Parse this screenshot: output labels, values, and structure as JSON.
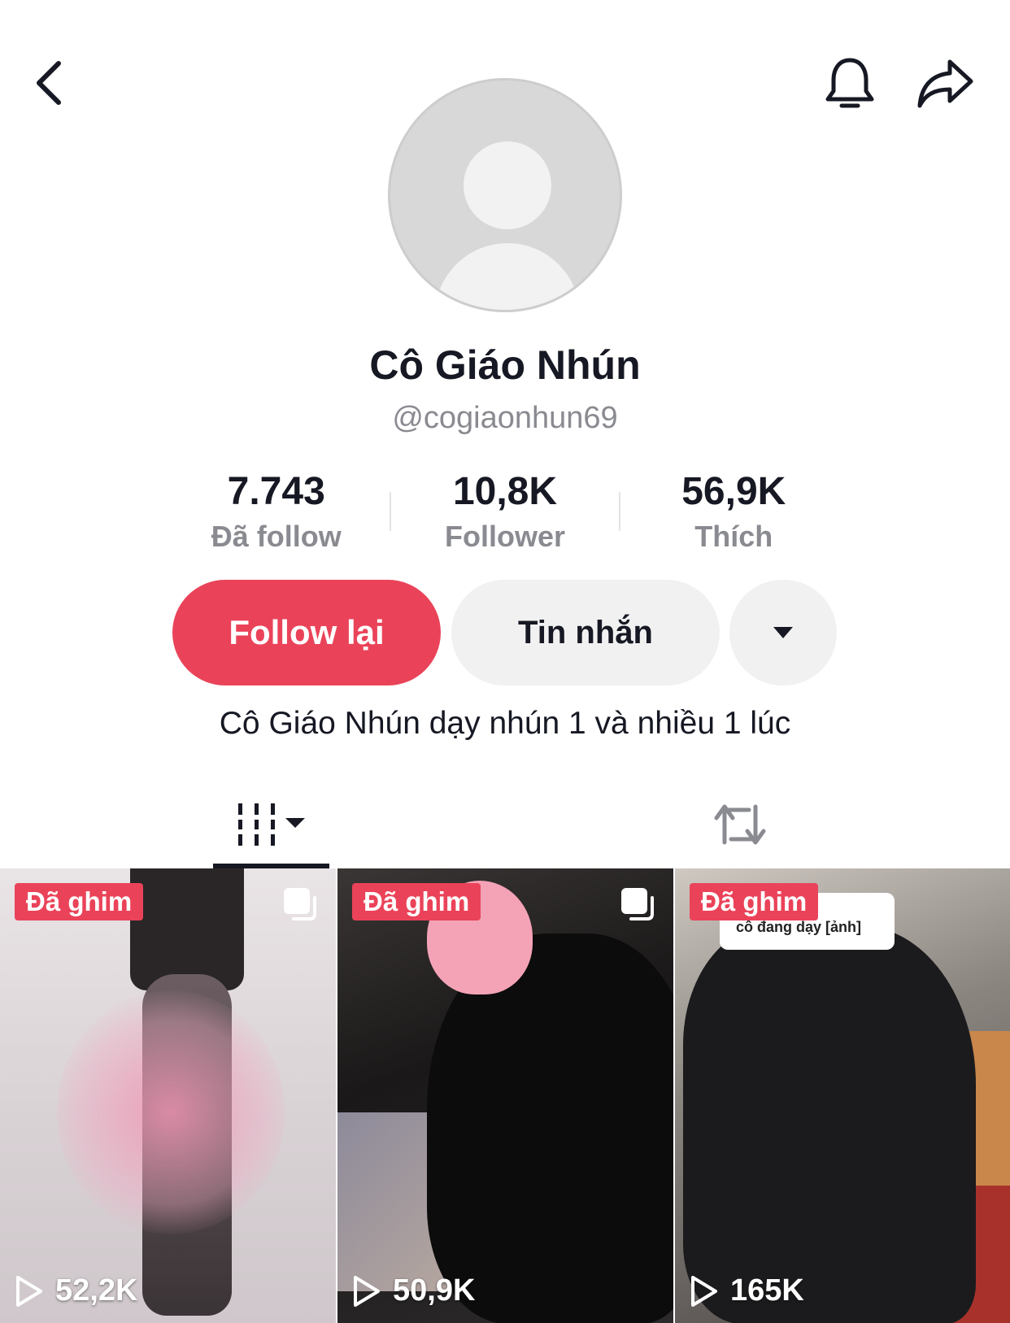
{
  "profile": {
    "display_name": "Cô Giáo Nhún",
    "username": "@cogiaonhun69",
    "bio": "Cô Giáo Nhún dạy nhún 1 và nhiều 1 lúc"
  },
  "stats": [
    {
      "value": "7.743",
      "label": "Đã follow"
    },
    {
      "value": "10,8K",
      "label": "Follower"
    },
    {
      "value": "56,9K",
      "label": "Thích"
    }
  ],
  "actions": {
    "follow_back": "Follow lại",
    "message": "Tin nhắn"
  },
  "tiles": [
    {
      "badge": "Đã ghim",
      "views": "52,2K"
    },
    {
      "badge": "Đã ghim",
      "views": "50,9K"
    },
    {
      "badge": "Đã ghim",
      "views": "165K",
      "overlay_text": "cô đang dạy [ảnh]"
    }
  ],
  "colors": {
    "accent": "#ea4359",
    "secondary_text": "#8a8b91",
    "button_bg": "#f1f1f2"
  }
}
